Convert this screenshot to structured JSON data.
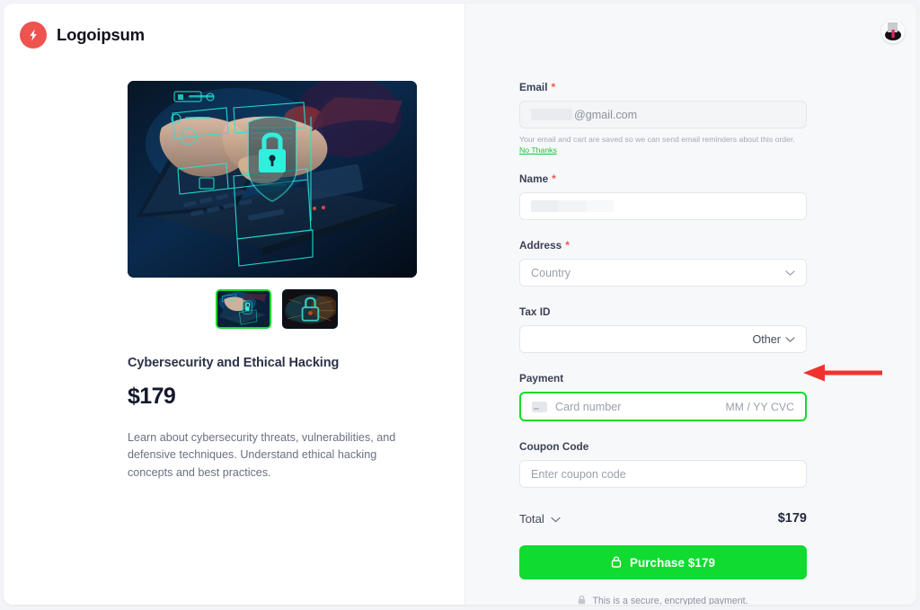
{
  "brand": {
    "name": "Logoipsum",
    "logo_icon": "lightning-bolt-icon",
    "logo_color": "#ef5350"
  },
  "product": {
    "title": "Cybersecurity and Ethical Hacking",
    "price": "$179",
    "description": "Learn about cybersecurity threats, vulnerabilities, and defensive techniques. Understand ethical hacking concepts and best practices.",
    "hero_alt": "hands typing on laptop with glowing cyan shield and padlock",
    "thumbnails": [
      {
        "alt": "laptop shield thumbnail",
        "selected": true
      },
      {
        "alt": "glowing padlock thumbnail",
        "selected": false
      }
    ]
  },
  "form": {
    "email": {
      "label": "Email",
      "required_marker": "*",
      "value_suffix": "@gmail.com",
      "redacted": true,
      "helper": "Your email and cart are saved so we can send email reminders about this order.",
      "helper_link": "No Thanks"
    },
    "name": {
      "label": "Name",
      "required_marker": "*",
      "redacted": true
    },
    "address": {
      "label": "Address",
      "required_marker": "*",
      "placeholder": "Country",
      "chevron_icon": "chevron-down-icon"
    },
    "tax_id": {
      "label": "Tax ID",
      "selected_option": "Other",
      "chevron_icon": "chevron-down-icon"
    },
    "payment": {
      "label": "Payment",
      "placeholder": "Card number",
      "expiry_cvc": "MM / YY  CVC",
      "card_icon": "credit-card-icon",
      "focused": true,
      "focus_color": "#16d92c"
    },
    "coupon": {
      "label": "Coupon Code",
      "placeholder": "Enter coupon code"
    }
  },
  "summary": {
    "total_label": "Total",
    "total_chevron_icon": "chevron-down-icon",
    "total_amount": "$179"
  },
  "purchase": {
    "label": "Purchase $179",
    "lock_icon": "lock-icon",
    "color": "#0fdb30"
  },
  "secure_note": {
    "text": "This is a secure, encrypted payment.",
    "lock_icon": "lock-icon"
  },
  "annotation": {
    "arrow_icon": "left-arrow-annotation",
    "color": "#f0322e"
  },
  "widget": {
    "name": "floating-avatar-widget"
  }
}
